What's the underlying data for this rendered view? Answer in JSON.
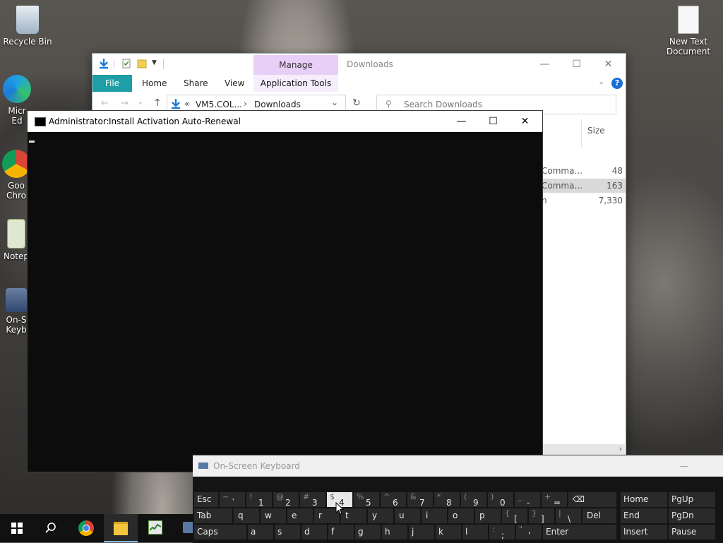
{
  "desktop": {
    "icons": [
      {
        "label": "Recycle Bin",
        "icon": "recycle-bin-icon"
      },
      {
        "label": "Micr\nEd",
        "icon": "edge-icon"
      },
      {
        "label": "Goo\nChro",
        "icon": "chrome-icon"
      },
      {
        "label": "Notep",
        "icon": "notepad-icon"
      },
      {
        "label": "On-S\nKeyb",
        "icon": "keyboard-icon"
      },
      {
        "label": "New Text\nDocument",
        "icon": "text-document-icon"
      }
    ]
  },
  "explorer": {
    "manage_tab": "Manage",
    "title": "Downloads",
    "ribbon": {
      "file": "File",
      "home": "Home",
      "share": "Share",
      "view": "View",
      "app_tools": "Application Tools"
    },
    "address": {
      "chevrons": "«",
      "path_part1": "VM5.COL...",
      "separator": "›",
      "path_part2": "Downloads"
    },
    "search_placeholder": "Search Downloads",
    "column_size": "Size",
    "rows": [
      {
        "type": "Comma...",
        "size": "48",
        "selected": false
      },
      {
        "type": "Comma...",
        "size": "163",
        "selected": true
      },
      {
        "type": "n",
        "size": "7,330",
        "selected": false
      }
    ],
    "colors": {
      "file_tab": "#1e9ea6",
      "manage_tab": "#e8cff7"
    }
  },
  "cmd": {
    "title_prefix": "Administrator:",
    "title": "Install Activation Auto-Renewal"
  },
  "osk": {
    "title": "On-Screen Keyboard",
    "rows": [
      [
        {
          "main": "Esc"
        },
        {
          "shift": "~",
          "main": "`"
        },
        {
          "shift": "!",
          "main": "1"
        },
        {
          "shift": "@",
          "main": "2"
        },
        {
          "shift": "#",
          "main": "3"
        },
        {
          "shift": "$",
          "main": "4",
          "highlight": true
        },
        {
          "shift": "%",
          "main": "5"
        },
        {
          "shift": "^",
          "main": "6"
        },
        {
          "shift": "&",
          "main": "7"
        },
        {
          "shift": "*",
          "main": "8"
        },
        {
          "shift": "(",
          "main": "9"
        },
        {
          "shift": ")",
          "main": "0"
        },
        {
          "shift": "_",
          "main": "-"
        },
        {
          "shift": "+",
          "main": "="
        },
        {
          "main": "⌫"
        },
        {
          "main": "Home"
        },
        {
          "main": "PgUp"
        }
      ],
      [
        {
          "main": "Tab"
        },
        {
          "main": "q"
        },
        {
          "main": "w"
        },
        {
          "main": "e"
        },
        {
          "main": "r"
        },
        {
          "main": "t"
        },
        {
          "main": "y"
        },
        {
          "main": "u"
        },
        {
          "main": "i"
        },
        {
          "main": "o"
        },
        {
          "main": "p"
        },
        {
          "shift": "{",
          "main": "["
        },
        {
          "shift": "}",
          "main": "]"
        },
        {
          "shift": "|",
          "main": "\\"
        },
        {
          "main": "Del"
        },
        {
          "main": "End"
        },
        {
          "main": "PgDn"
        }
      ],
      [
        {
          "main": "Caps"
        },
        {
          "main": "a"
        },
        {
          "main": "s"
        },
        {
          "main": "d"
        },
        {
          "main": "f"
        },
        {
          "main": "g"
        },
        {
          "main": "h"
        },
        {
          "main": "j"
        },
        {
          "main": "k"
        },
        {
          "main": "l"
        },
        {
          "shift": ":",
          "main": ";"
        },
        {
          "shift": "\"",
          "main": "'"
        },
        {
          "main": "Enter"
        },
        {
          "main": "Insert"
        },
        {
          "main": "Pause"
        }
      ]
    ]
  },
  "taskbar": {
    "items": [
      "windows-start-icon",
      "search-icon",
      "chrome-icon",
      "file-explorer-icon",
      "task-manager-icon",
      "keyboard-icon"
    ]
  }
}
